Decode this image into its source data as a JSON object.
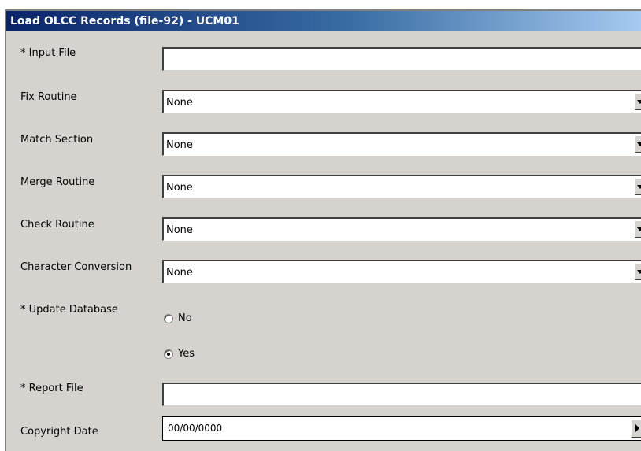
{
  "window": {
    "title": "Load OLCC Records (file-92) - UCM01"
  },
  "fields": {
    "input_file": {
      "label": "* Input File",
      "value": ""
    },
    "fix_routine": {
      "label": "Fix Routine",
      "value": "None"
    },
    "match_section": {
      "label": "Match Section",
      "value": "None"
    },
    "merge_routine": {
      "label": "Merge Routine",
      "value": "None"
    },
    "check_routine": {
      "label": "Check Routine",
      "value": "None"
    },
    "character_conversion": {
      "label": "Character Conversion",
      "value": "None"
    },
    "update_database": {
      "label": "* Update Database",
      "options": [
        {
          "label": "No",
          "checked": false
        },
        {
          "label": "Yes",
          "checked": true
        }
      ]
    },
    "report_file": {
      "label": "* Report File",
      "value": ""
    },
    "copyright_date": {
      "label": "Copyright Date",
      "value": "00/00/0000"
    }
  },
  "colors": {
    "title_gradient_start": "#0a246a",
    "title_gradient_end": "#a6caf0",
    "panel_bg": "#d6d3ce"
  }
}
